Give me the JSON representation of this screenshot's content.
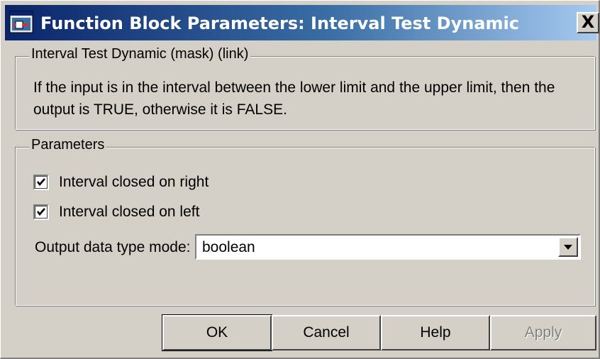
{
  "window": {
    "title": "Function Block Parameters: Interval Test Dynamic",
    "close_label": "X",
    "app_icon": "simulink-block-icon"
  },
  "mask_group": {
    "legend": "Interval Test Dynamic (mask) (link)",
    "description_line1": "If the input is in the interval between the lower limit and the upper limit, then the",
    "description_line2": "output is TRUE, otherwise it is FALSE."
  },
  "parameters_group": {
    "legend": "Parameters",
    "checkboxes": [
      {
        "label": "Interval closed on right",
        "checked": true
      },
      {
        "label": "Interval closed on left",
        "checked": true
      }
    ],
    "output_mode": {
      "label": "Output data type mode:",
      "value": "boolean"
    }
  },
  "buttons": {
    "ok": "OK",
    "cancel": "Cancel",
    "help": "Help",
    "apply": "Apply"
  },
  "colors": {
    "title_gradient_start": "#0a246a",
    "title_gradient_end": "#a6caf0",
    "face": "#d4d0c8"
  }
}
